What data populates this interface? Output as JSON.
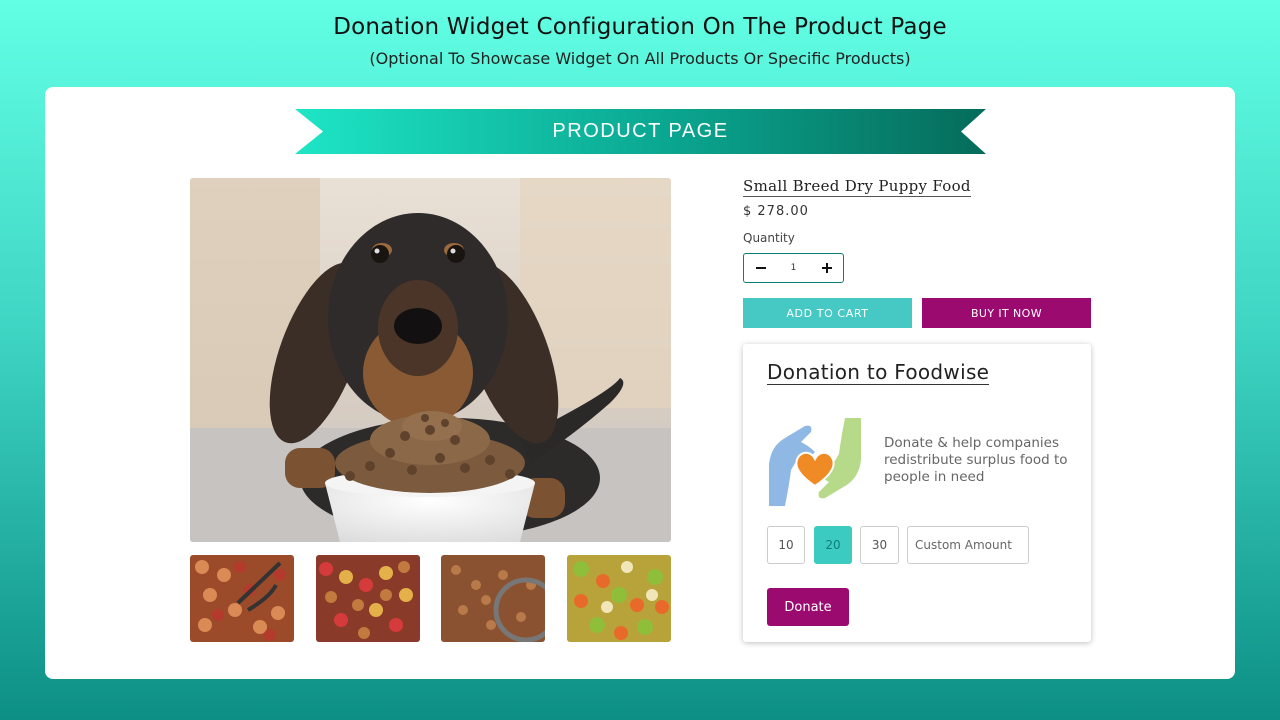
{
  "header": {
    "title": "Donation Widget Configuration On The Product Page",
    "subtitle": "(Optional To Showcase Widget On All Products Or Specific Products)"
  },
  "banner": {
    "label": "PRODUCT PAGE"
  },
  "product": {
    "title": "Small Breed Dry Puppy Food",
    "price": "$ 278.00",
    "quantity_label": "Quantity",
    "quantity_value": "1",
    "add_to_cart_label": "ADD TO CART",
    "buy_now_label": "BUY IT NOW",
    "main_image_icon": "dog-with-food-bowl-image",
    "thumbnails": [
      "kibble-with-scoop-image",
      "colorful-kibble-image",
      "kibble-bowl-image",
      "green-orange-kibble-image"
    ]
  },
  "donation": {
    "title": "Donation to Foodwise",
    "description": "Donate & help companies redistribute surplus food to people in need",
    "logo_icon": "hands-holding-heart-icon",
    "amounts": [
      "10",
      "20",
      "30"
    ],
    "selected_amount": "20",
    "custom_placeholder": "Custom Amount",
    "donate_label": "Donate"
  },
  "colors": {
    "accent_teal": "#46c8c4",
    "accent_magenta": "#9b0a6f"
  }
}
